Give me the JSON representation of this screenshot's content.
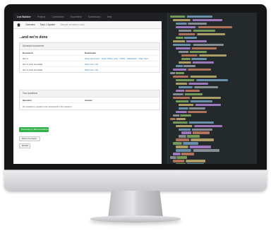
{
  "app": {
    "brand": "List Builder",
    "nav": [
      "Projects",
      "Contributors",
      "Documents",
      "Submissions",
      "Help"
    ]
  },
  "tabs": {
    "home_icon": "home-icon",
    "items": [
      "Overview",
      "Task 1 System",
      "Sample annotation task"
    ]
  },
  "page": {
    "title": "...and we're done"
  },
  "sections": {
    "documents": {
      "header": "Uploaded documents",
      "columns": [
        "Document",
        "Downloads"
      ],
      "rows": [
        {
          "name": "Item 1",
          "links": "Word document · Open Office (odt) · HTML · Markdown · Plain Text"
        },
        {
          "name": "Item 2 (raw text data)",
          "links": "Plain text (.txt)"
        },
        {
          "name": "Item 3 (raw text data)",
          "links": "Plain text (.txt)"
        }
      ]
    },
    "questions": {
      "header": "Your questions",
      "columns": [
        "Question",
        "Answer"
      ],
      "empty_text": "No questions needed to be answered in this session."
    }
  },
  "buttons": {
    "primary": "Download my filled annotations",
    "secondary": "Return to project",
    "tertiary": "Review"
  },
  "colors": {
    "accent": "#33b14b",
    "link": "#2a7ab8",
    "editor_bg": "#24292c"
  }
}
